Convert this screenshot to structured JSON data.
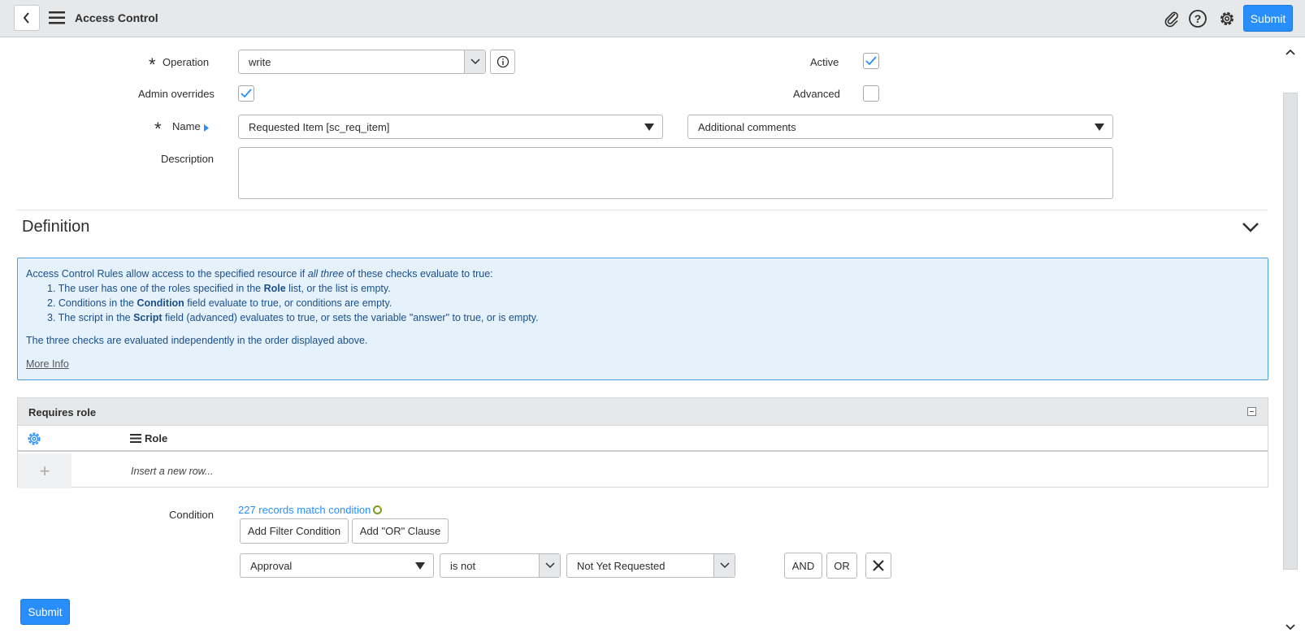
{
  "header": {
    "title": "Access Control",
    "submit_label": "Submit"
  },
  "form": {
    "operation": {
      "label": "Operation",
      "value": "write"
    },
    "active": {
      "label": "Active",
      "checked": true
    },
    "admin_overrides": {
      "label": "Admin overrides",
      "checked": true
    },
    "advanced": {
      "label": "Advanced",
      "checked": false
    },
    "name": {
      "label": "Name",
      "table_value": "Requested Item [sc_req_item]",
      "field_value": "Additional comments"
    },
    "description": {
      "label": "Description",
      "value": ""
    }
  },
  "definition": {
    "title": "Definition",
    "info": {
      "intro_pre": "Access Control Rules allow access to the specified resource if ",
      "intro_em": "all three",
      "intro_post": " of these checks evaluate to true:",
      "item1_pre": "1. The user has one of the roles specified in the ",
      "item1_bold": "Role",
      "item1_post": " list, or the list is empty.",
      "item2_pre": "2. Conditions in the ",
      "item2_bold": "Condition",
      "item2_post": " field evaluate to true, or conditions are empty.",
      "item3_pre": "3. The script in the ",
      "item3_bold": "Script",
      "item3_post": " field (advanced) evaluates to true, or sets the variable \"answer\" to true, or is empty.",
      "footer": "The three checks are evaluated independently in the order displayed above.",
      "more_info": "More Info"
    }
  },
  "requires_role": {
    "title": "Requires role",
    "column": "Role",
    "insert_row": "Insert a new row..."
  },
  "condition": {
    "label": "Condition",
    "records_link": "227 records match condition",
    "add_filter": "Add Filter Condition",
    "add_or": "Add \"OR\" Clause",
    "field": "Approval",
    "operator": "is not",
    "value": "Not Yet Requested",
    "and_label": "AND",
    "or_label": "OR"
  },
  "footer": {
    "submit_label": "Submit"
  },
  "colors": {
    "accent": "#278efc",
    "info_bg": "#e5f1fb",
    "info_border": "#53a0e0"
  }
}
